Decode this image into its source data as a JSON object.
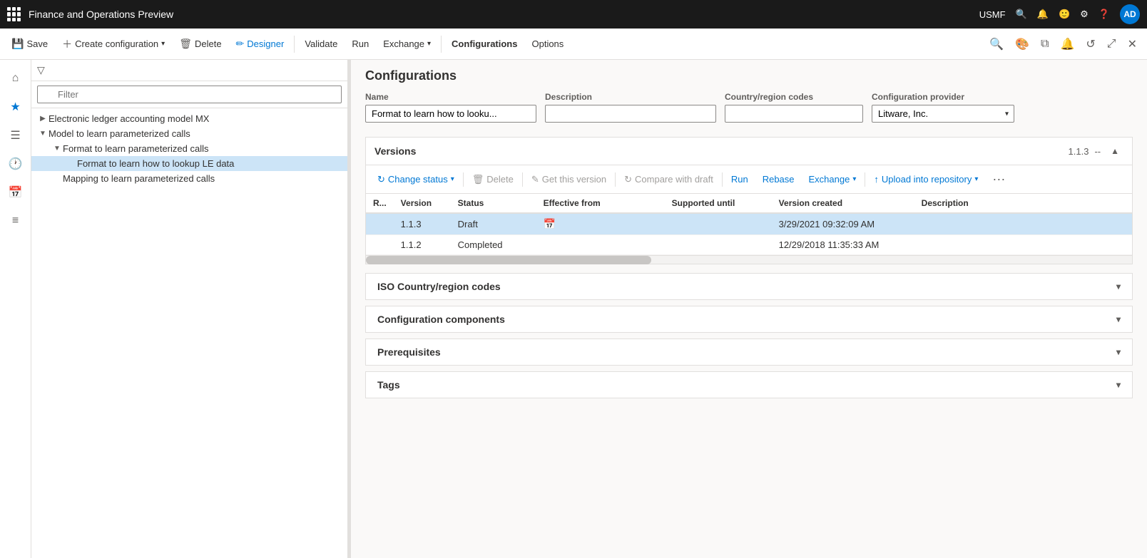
{
  "topbar": {
    "title": "Finance and Operations Preview",
    "user": "USMF",
    "avatar_label": "AD"
  },
  "toolbar": {
    "save": "Save",
    "create_config": "Create configuration",
    "delete": "Delete",
    "designer": "Designer",
    "validate": "Validate",
    "run": "Run",
    "exchange": "Exchange",
    "configurations": "Configurations",
    "options": "Options"
  },
  "filter_placeholder": "Filter",
  "tree": {
    "items": [
      {
        "id": "electronic-ledger",
        "label": "Electronic ledger accounting model MX",
        "indent": 0,
        "expanded": false,
        "selected": false
      },
      {
        "id": "model-learn",
        "label": "Model to learn parameterized calls",
        "indent": 0,
        "expanded": true,
        "selected": false
      },
      {
        "id": "format-learn",
        "label": "Format to learn parameterized calls",
        "indent": 1,
        "expanded": true,
        "selected": false
      },
      {
        "id": "format-lookup",
        "label": "Format to learn how to lookup LE data",
        "indent": 2,
        "expanded": false,
        "selected": true
      },
      {
        "id": "mapping-learn",
        "label": "Mapping to learn parameterized calls",
        "indent": 1,
        "expanded": false,
        "selected": false
      }
    ]
  },
  "configurations": {
    "title": "Configurations",
    "form": {
      "name_label": "Name",
      "name_value": "Format to learn how to looku...",
      "description_label": "Description",
      "description_value": "",
      "country_label": "Country/region codes",
      "country_value": "",
      "provider_label": "Configuration provider",
      "provider_value": "Litware, Inc."
    },
    "versions": {
      "title": "Versions",
      "badge": "1.1.3",
      "separator": "--",
      "toolbar": {
        "change_status": "Change status",
        "delete": "Delete",
        "get_this_version": "Get this version",
        "compare_with_draft": "Compare with draft",
        "run": "Run",
        "rebase": "Rebase",
        "exchange": "Exchange",
        "upload_into_repository": "Upload into repository"
      },
      "table": {
        "columns": [
          "R...",
          "Version",
          "Status",
          "Effective from",
          "Supported until",
          "Version created",
          "Description"
        ],
        "rows": [
          {
            "r": "",
            "version": "1.1.3",
            "status": "Draft",
            "effective_from": "",
            "supported_until": "",
            "version_created": "3/29/2021 09:32:09 AM",
            "description": "",
            "selected": true
          },
          {
            "r": "",
            "version": "1.1.2",
            "status": "Completed",
            "effective_from": "",
            "supported_until": "",
            "version_created": "12/29/2018 11:35:33 AM",
            "description": "",
            "selected": false
          }
        ]
      }
    },
    "sections": [
      {
        "id": "iso-country",
        "title": "ISO Country/region codes",
        "expanded": false
      },
      {
        "id": "config-components",
        "title": "Configuration components",
        "expanded": false
      },
      {
        "id": "prerequisites",
        "title": "Prerequisites",
        "expanded": false
      },
      {
        "id": "tags",
        "title": "Tags",
        "expanded": false
      }
    ]
  }
}
